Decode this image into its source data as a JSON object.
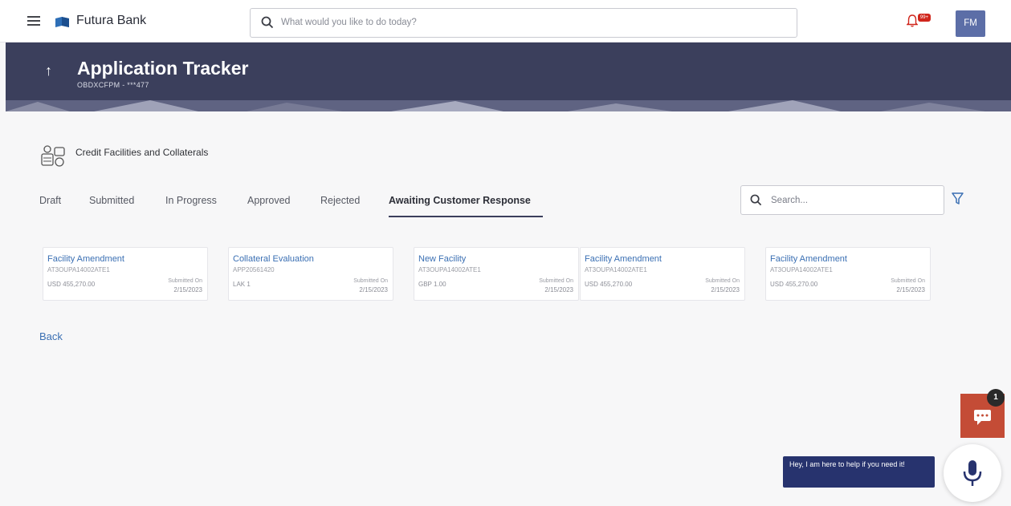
{
  "header": {
    "brand": "Futura Bank",
    "search_placeholder": "What would you like to do today?",
    "notification_count": "99+",
    "avatar_initials": "FM"
  },
  "hero": {
    "title": "Application Tracker",
    "subtitle": "OBDXCFPM - ***477"
  },
  "section": {
    "title": "Credit Facilities and Collaterals"
  },
  "tabs": [
    {
      "label": "Draft"
    },
    {
      "label": "Submitted"
    },
    {
      "label": "In Progress"
    },
    {
      "label": "Approved"
    },
    {
      "label": "Rejected"
    },
    {
      "label": "Awaiting Customer Response",
      "active": true
    }
  ],
  "search": {
    "placeholder": "Search..."
  },
  "cards": [
    {
      "title": "Facility Amendment",
      "ref": "AT3OUPA14002ATE1",
      "amount": "USD 455,270.00",
      "submitted_label": "Submitted On",
      "submitted_date": "2/15/2023"
    },
    {
      "title": "Collateral Evaluation",
      "ref": "APP20561420",
      "amount": "LAK 1",
      "submitted_label": "Submitted On",
      "submitted_date": "2/15/2023"
    },
    {
      "title": "New Facility",
      "ref": "AT3OUPA14002ATE1",
      "amount": "GBP 1.00",
      "submitted_label": "Submitted On",
      "submitted_date": "2/15/2023"
    },
    {
      "title": "Facility Amendment",
      "ref": "AT3OUPA14002ATE1",
      "amount": "USD 455,270.00",
      "submitted_label": "Submitted On",
      "submitted_date": "2/15/2023"
    },
    {
      "title": "Facility Amendment",
      "ref": "AT3OUPA14002ATE1",
      "amount": "USD 455,270.00",
      "submitted_label": "Submitted On",
      "submitted_date": "2/15/2023"
    }
  ],
  "back_label": "Back",
  "chat": {
    "badge": "1",
    "bubble_text": "Hey, I am here to help if you need it!"
  },
  "colors": {
    "hero_bg": "#3b3f5c",
    "link": "#3a6fb3",
    "chat_accent": "#c44c36",
    "bot_bubble": "#27336e"
  }
}
